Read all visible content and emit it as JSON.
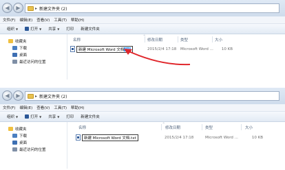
{
  "window": {
    "breadcrumb_separator": "▸",
    "folder_name": "新建文件夹 (2)"
  },
  "menu": [
    "文件(F)",
    "编辑(E)",
    "查看(V)",
    "工具(T)",
    "帮助(H)"
  ],
  "toolbar": {
    "organize": "组织",
    "open": "打开",
    "share": "共享",
    "print": "打印",
    "new_folder": "新建文件夹"
  },
  "sidebar": {
    "favorites": "收藏夹",
    "items": [
      "下载",
      "桌面",
      "最近访问的位置"
    ]
  },
  "columns": {
    "name": "名称",
    "modified": "修改日期",
    "type": "类型",
    "size": "大小"
  },
  "screens": [
    {
      "file_name_selected": "新建 Microsoft Word 文档",
      "file_name_extension_selected": ".txt",
      "modified": "2015/2/4 17:18",
      "type": "Microsoft Word ...",
      "size": "10 KB"
    },
    {
      "file_name_full": "新建 Microsoft Word 文档.txt",
      "modified": "2015/2/4 17:18",
      "type": "Microsoft Word ...",
      "size": "10 KB"
    }
  ],
  "colors": {
    "selection": "#3399ff",
    "arrow": "#e0262b"
  }
}
